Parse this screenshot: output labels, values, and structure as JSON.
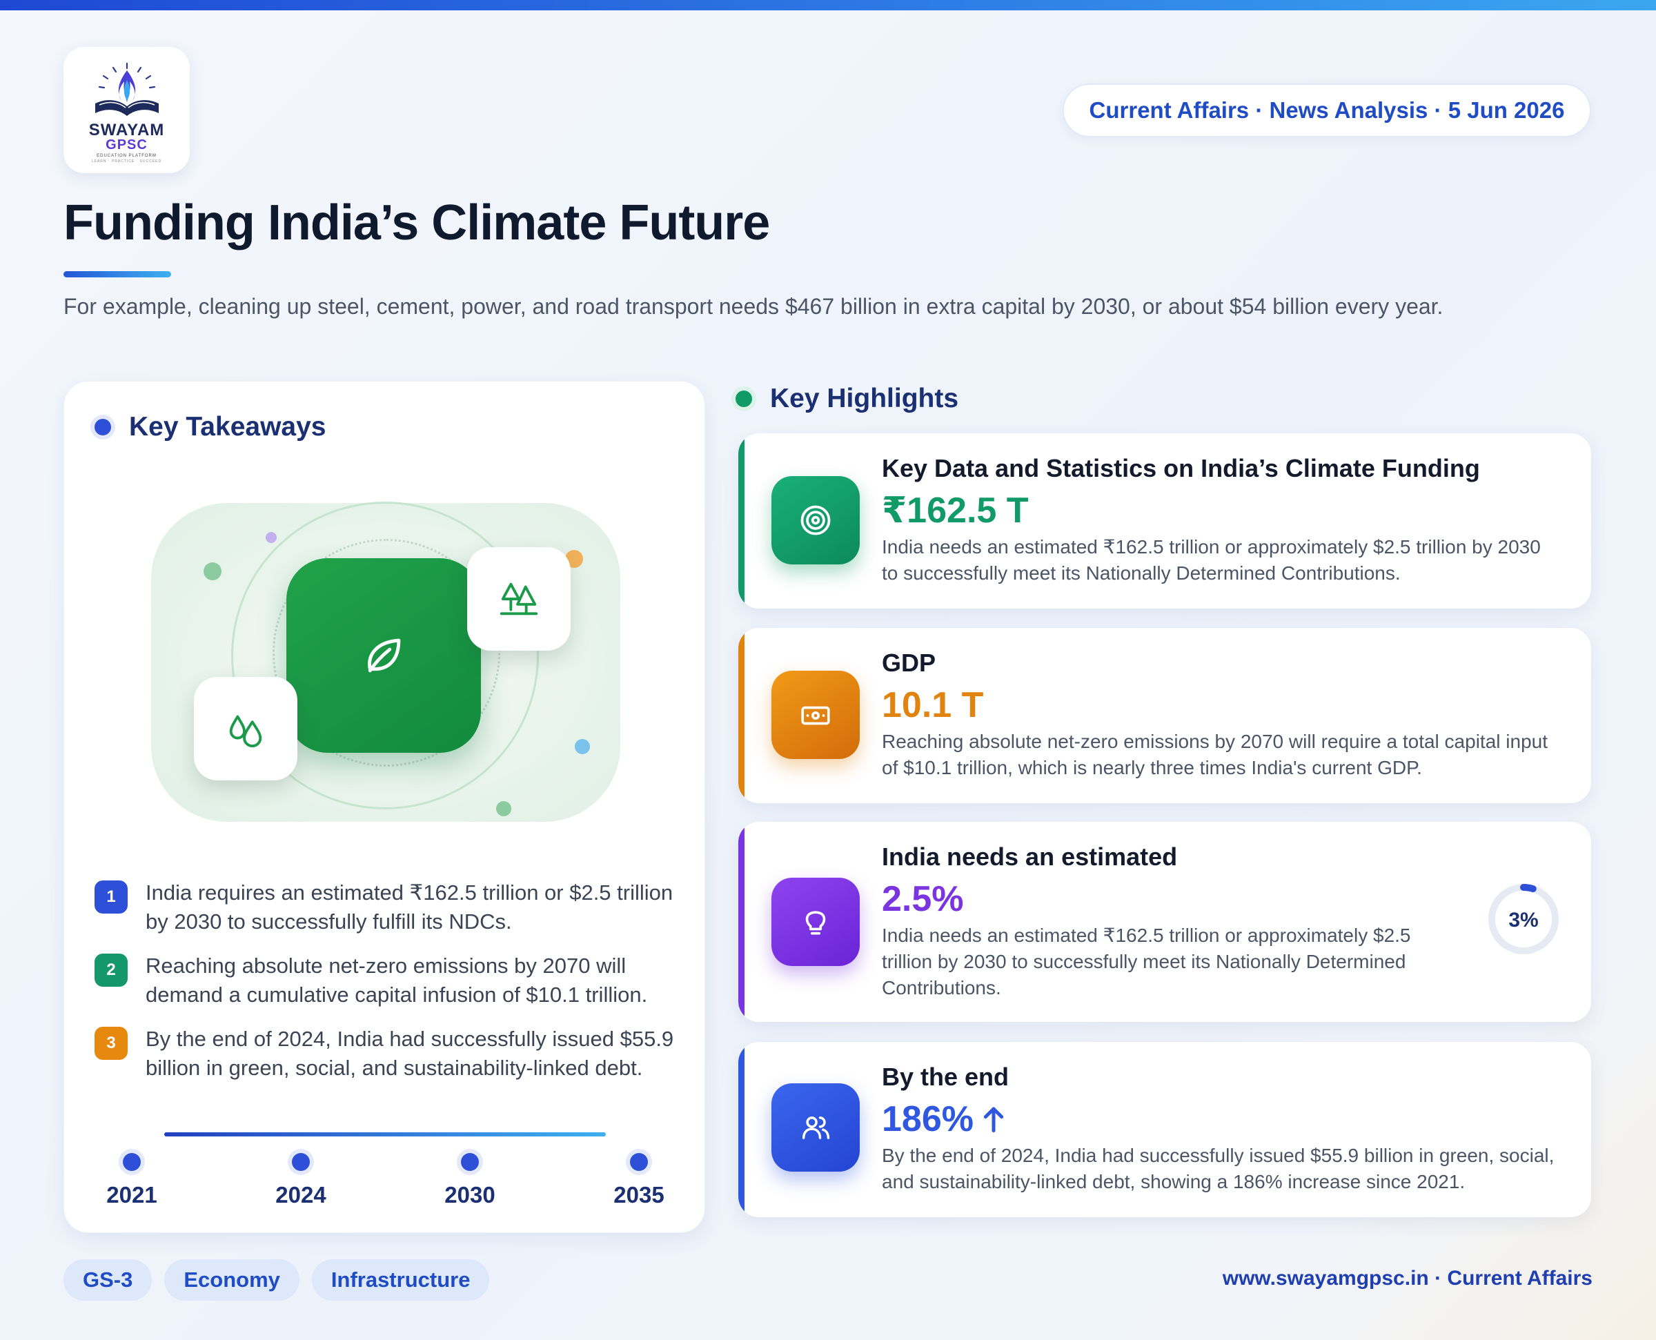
{
  "header": {
    "logo": {
      "name": "SWAYAM",
      "sub": "GPSC",
      "tagline": "EDUCATION PLATFORM",
      "motto": "LEARN · PRACTICE · SUCCEED"
    },
    "badge": "Current Affairs · News Analysis · 5 Jun 2026"
  },
  "title": "Funding India’s Climate Future",
  "intro": "For example, cleaning up steel, cement, power, and road transport needs $467 billion in extra capital by 2030, or about $54 billion every year.",
  "takeaways": {
    "heading": "Key Takeaways",
    "items": [
      {
        "num": "1",
        "text": "India requires an estimated ₹162.5 trillion or $2.5 trillion by 2030 to successfully fulfill its NDCs."
      },
      {
        "num": "2",
        "text": "Reaching absolute net-zero emissions by 2070 will demand a cumulative capital infusion of $10.1 trillion."
      },
      {
        "num": "3",
        "text": "By the end of 2024, India had successfully issued $55.9 billion in green, social, and sustainability-linked debt."
      }
    ],
    "timeline": [
      "2021",
      "2024",
      "2030",
      "2035"
    ]
  },
  "highlights": {
    "heading": "Key Highlights",
    "cards": [
      {
        "title": "Key Data and Statistics on India’s Climate Funding",
        "value": "₹162.5 T",
        "desc": "India needs an estimated ₹162.5 trillion or approximately $2.5 trillion by 2030 to successfully meet its Nationally Determined Contributions.",
        "color": "#0f9a67",
        "icon": "target-icon"
      },
      {
        "title": "GDP",
        "value": "10.1 T",
        "desc": "Reaching absolute net-zero emissions by 2070 will require a total capital input of $10.1 trillion, which is nearly three times India's current GDP.",
        "color": "#e0830f",
        "icon": "banknote-icon"
      },
      {
        "title": "India needs an estimated",
        "value": "2.5%",
        "desc": "India needs an estimated ₹162.5 trillion or approximately $2.5 trillion by 2030 to successfully meet its Nationally Determined Contributions.",
        "color": "#7a34e0",
        "icon": "lightbulb-icon",
        "gauge_label": "3%",
        "gauge_fraction": 0.03
      },
      {
        "title": "By the end",
        "value": "186%",
        "desc": "By the end of 2024, India had successfully issued $55.9 billion in green, social, and sustainability-linked debt, showing a 186% increase since 2021.",
        "color": "#2f57e0",
        "icon": "users-icon"
      }
    ]
  },
  "tags": [
    "GS-3",
    "Economy",
    "Infrastructure"
  ],
  "footer": "www.swayamgpsc.in · Current Affairs"
}
